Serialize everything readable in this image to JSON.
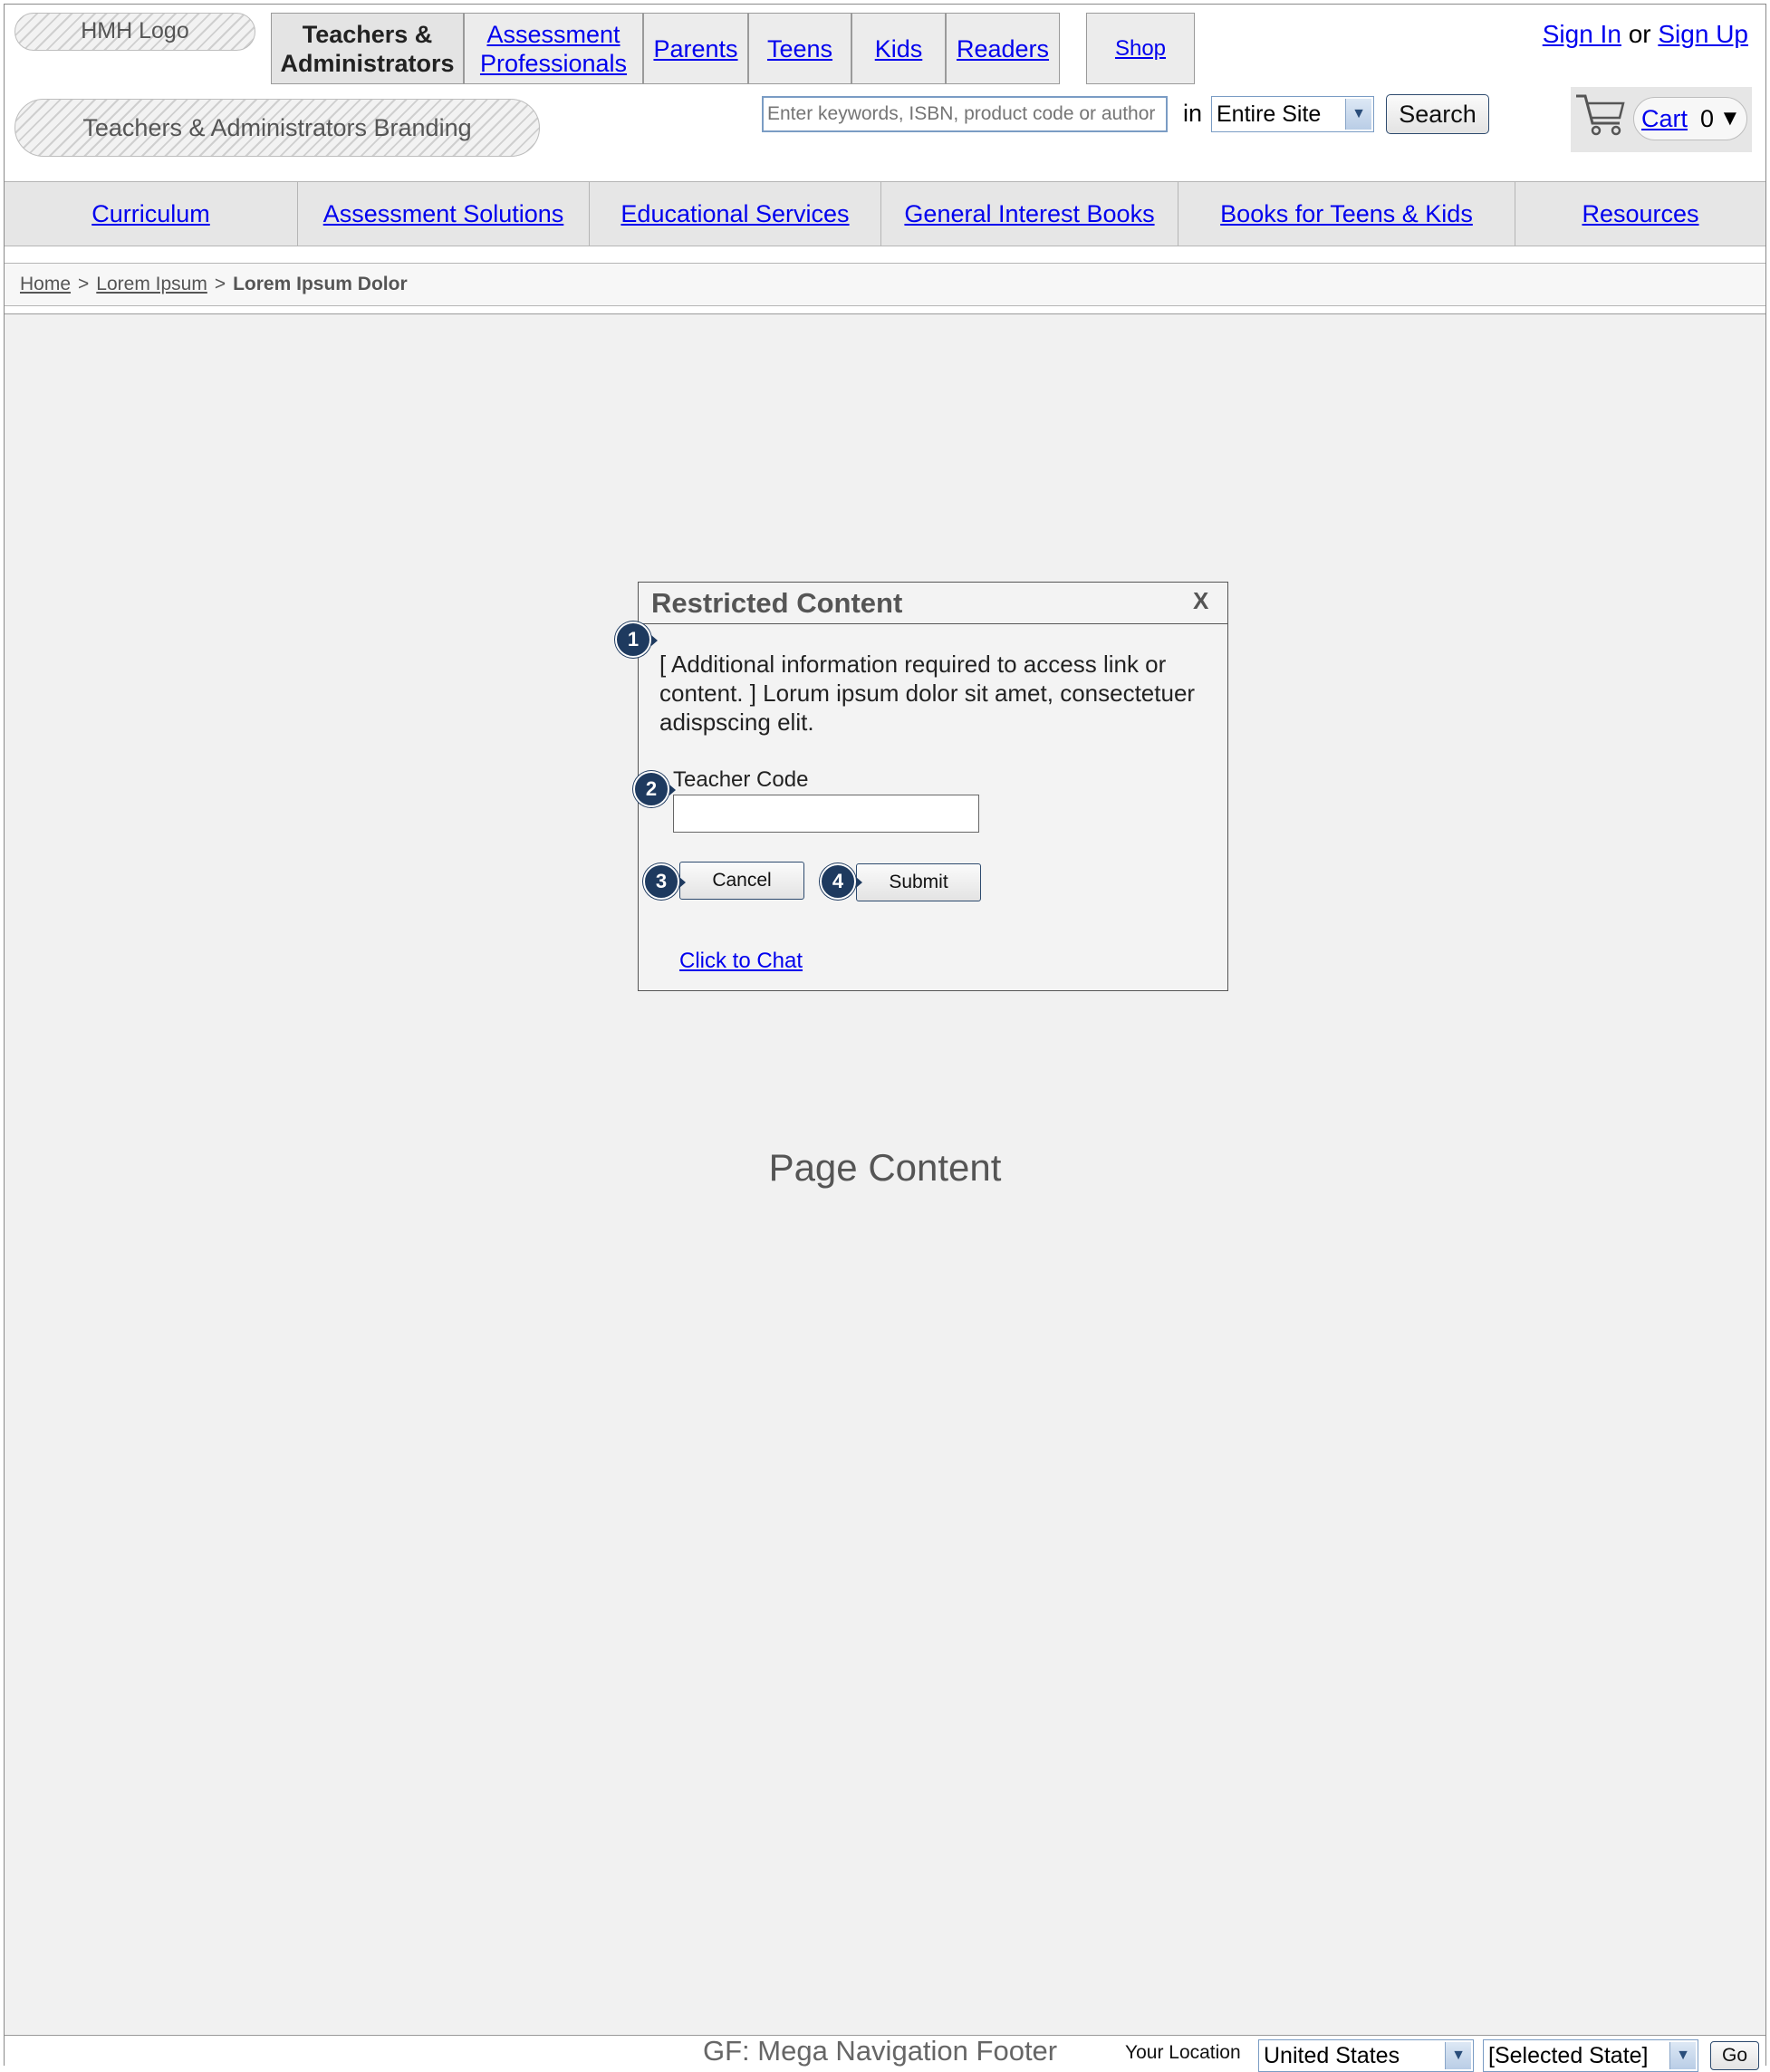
{
  "header": {
    "logo": "HMH Logo",
    "branding": "Teachers & Administrators Branding",
    "tabs": [
      {
        "line1": "Teachers &",
        "line2": "Administrators"
      },
      {
        "line1": "Assessment",
        "line2": "Professionals"
      },
      {
        "label": "Parents"
      },
      {
        "label": "Teens"
      },
      {
        "label": "Kids"
      },
      {
        "label": "Readers"
      }
    ],
    "shop": "Shop",
    "sign_in": "Sign In",
    "or": "or",
    "sign_up": "Sign Up"
  },
  "search": {
    "placeholder": "Enter keywords, ISBN, product code or author",
    "in_label": "in",
    "scope": "Entire Site",
    "button": "Search"
  },
  "cart": {
    "label": "Cart",
    "count": "0",
    "caret": "▼"
  },
  "nav": {
    "items": [
      "Curriculum",
      "Assessment Solutions",
      "Educational Services",
      "General Interest Books",
      "Books for Teens & Kids",
      "Resources"
    ]
  },
  "breadcrumb": {
    "home": "Home",
    "sep": ">",
    "level1": "Lorem Ipsum",
    "current": "Lorem Ipsum Dolor"
  },
  "main": {
    "placeholder": "Page Content"
  },
  "dialog": {
    "title": "Restricted Content",
    "close": "X",
    "message": "[ Additional information required to access link or content. ] Lorum ipsum dolor sit amet, consectetuer adispscing elit.",
    "field_label": "Teacher Code",
    "field_value": "",
    "cancel": "Cancel",
    "submit": "Submit",
    "chat": "Click to Chat",
    "badges": [
      "1",
      "2",
      "3",
      "4"
    ]
  },
  "footer": {
    "title": "GF: Mega Navigation Footer",
    "location_label": "Your Location",
    "country": "United States",
    "state": "[Selected State]",
    "go": "Go"
  },
  "icons": [
    "cart-icon",
    "chevron-down-icon"
  ],
  "colors": {
    "link": "#0000ee",
    "badge": "#1e3a5f",
    "page_bg": "#f1f1f1"
  }
}
